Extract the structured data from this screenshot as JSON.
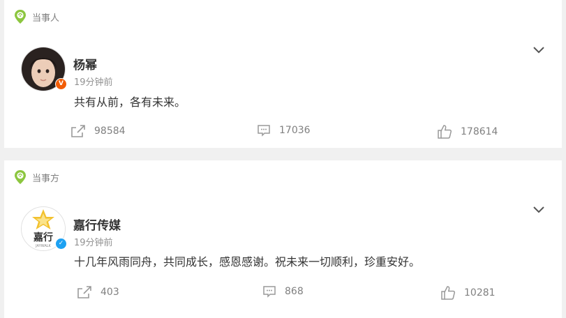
{
  "posts": [
    {
      "section_label": "当事人",
      "author": "杨幂",
      "time": "19分钟前",
      "text": "共有从前，各有未来。",
      "badge": "V",
      "reposts": "98584",
      "comments": "17036",
      "likes": "178614"
    },
    {
      "section_label": "当事方",
      "author": "嘉行传媒",
      "avatar_text": "嘉行",
      "avatar_subtext": "JAYWALK",
      "time": "19分钟前",
      "text": "十几年风雨同舟，共同成长，感恩感谢。祝未来一切顺利，珍重安好。",
      "badge": "✓",
      "reposts": "403",
      "comments": "868",
      "likes": "10281"
    }
  ],
  "colors": {
    "pin_green": "#8cc63f",
    "badge_orange": "#f25c05",
    "badge_blue": "#1da1f2",
    "jaywalk_gold": "#f2c12e"
  }
}
